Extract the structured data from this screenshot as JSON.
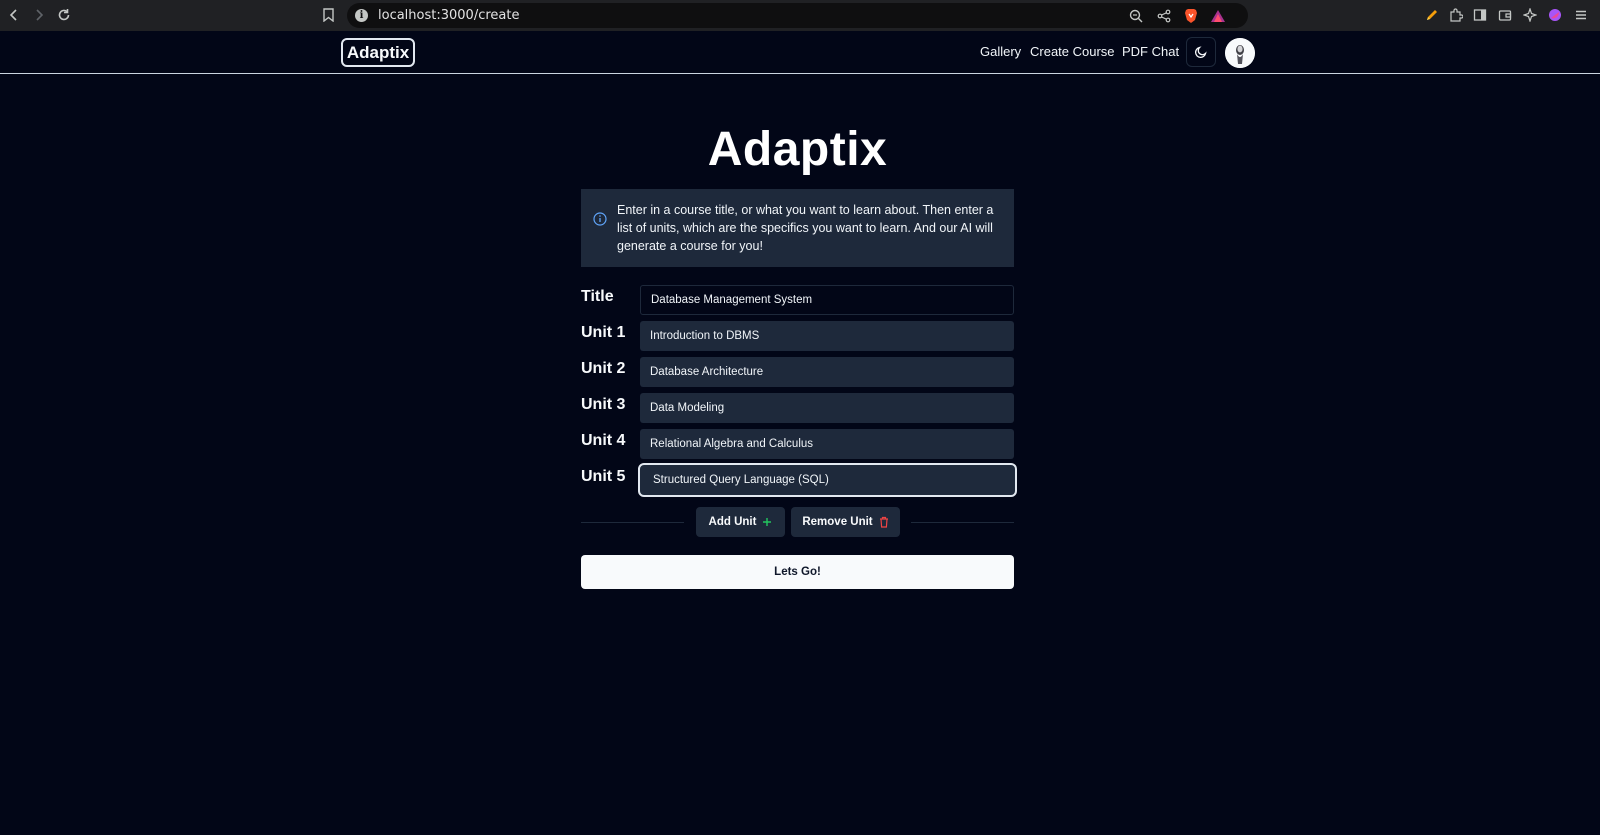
{
  "browser": {
    "url": "localhost:3000/create"
  },
  "header": {
    "logo": "Adaptix",
    "nav": [
      "Gallery",
      "Create Course",
      "PDF Chat"
    ]
  },
  "main": {
    "title": "Adaptix",
    "info": "Enter in a course title, or what you want to learn about. Then enter a list of units, which are the specifics you want to learn. And our AI will generate a course for you!",
    "title_label": "Title",
    "title_value": "Database Management System",
    "units": [
      {
        "label": "Unit 1",
        "value": "Introduction to DBMS"
      },
      {
        "label": "Unit 2",
        "value": "Database Architecture"
      },
      {
        "label": "Unit 3",
        "value": "Data Modeling"
      },
      {
        "label": "Unit 4",
        "value": "Relational Algebra and Calculus"
      },
      {
        "label": "Unit 5",
        "value": "Structured Query Language (SQL)"
      }
    ],
    "add_unit": "Add Unit",
    "remove_unit": "Remove Unit",
    "submit": "Lets Go!"
  },
  "colors": {
    "background": "#020617",
    "card": "#1e293b",
    "primary": "#f8fafc",
    "add_icon": "#22c55e",
    "remove_icon": "#ef4444",
    "info_icon": "#60a5fa"
  },
  "icons": {
    "back": "chevron-left-icon",
    "forward": "chevron-right-icon",
    "reload": "reload-icon",
    "bookmark": "bookmark-icon",
    "zoom": "zoom-icon",
    "share": "share-icon",
    "theme": "moon-icon",
    "info": "info-icon",
    "add": "plus-icon",
    "remove": "trash-icon"
  }
}
